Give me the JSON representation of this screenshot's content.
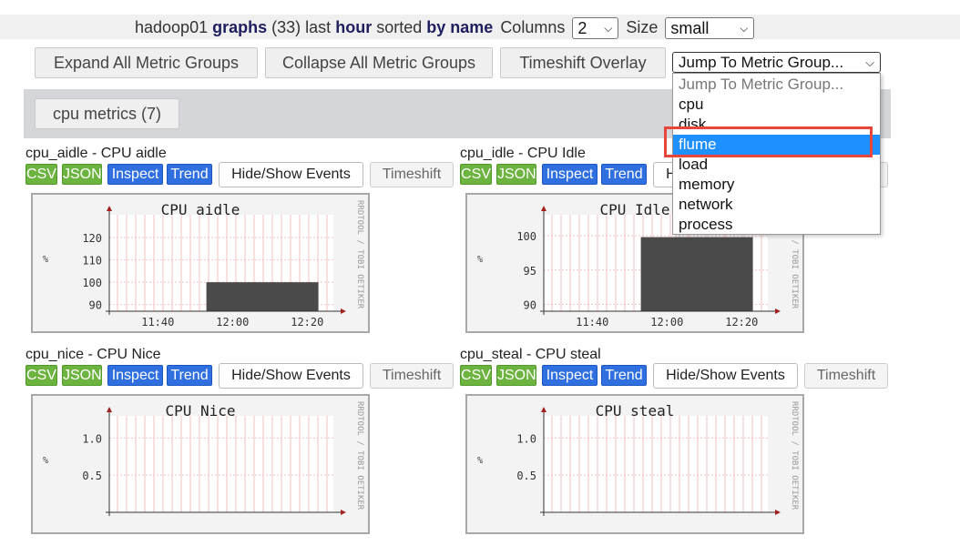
{
  "header": {
    "host": "hadoop01",
    "graphs_word": "graphs",
    "count": "(33)",
    "last_word": "last",
    "range": "hour",
    "sorted_word": "sorted",
    "sort": "by name",
    "columns_label": "Columns",
    "columns_value": "2",
    "size_label": "Size",
    "size_value": "small"
  },
  "toolbar": {
    "expand": "Expand All Metric Groups",
    "collapse": "Collapse All Metric Groups",
    "timeshift_overlay": "Timeshift Overlay",
    "jump_placeholder": "Jump To Metric Group..."
  },
  "dropdown": {
    "options": [
      "Jump To Metric Group...",
      "cpu",
      "disk",
      "flume",
      "load",
      "memory",
      "network",
      "process"
    ],
    "selected": "flume"
  },
  "group": {
    "label": "cpu metrics (7)"
  },
  "graph_buttons": [
    "CSV",
    "JSON",
    "Inspect",
    "Trend",
    "Hide/Show Events",
    "Timeshift"
  ],
  "side_text": "RRDTOOL / TOBI OETIKER",
  "ylabel": "%",
  "graphs": [
    {
      "title": "cpu_aidle - CPU aidle",
      "chart_data": {
        "type": "area",
        "title": "CPU aidle",
        "x_ticks": [
          "11:40",
          "12:00",
          "12:20"
        ],
        "y_ticks": [
          "120",
          "110",
          "100",
          "90"
        ],
        "ylim": [
          87,
          127
        ],
        "series": [
          {
            "x_start": "11:53",
            "x_end": "12:23",
            "value": 100
          }
        ]
      }
    },
    {
      "title": "cpu_idle - CPU Idle",
      "chart_data": {
        "type": "area",
        "title": "CPU Idle",
        "x_ticks": [
          "11:40",
          "12:00",
          "12:20"
        ],
        "y_ticks": [
          "100",
          "95",
          "90"
        ],
        "ylim": [
          89,
          102
        ],
        "series": [
          {
            "x_start": "11:53",
            "x_end": "12:23",
            "value": 99.8
          }
        ]
      }
    },
    {
      "title": "cpu_nice - CPU Nice",
      "chart_data": {
        "type": "area",
        "title": "CPU Nice",
        "x_ticks": [],
        "y_ticks": [
          "1.0",
          "0.5"
        ],
        "ylim": [
          0,
          1.2
        ],
        "series": []
      }
    },
    {
      "title": "cpu_steal - CPU steal",
      "chart_data": {
        "type": "area",
        "title": "CPU steal",
        "x_ticks": [],
        "y_ticks": [
          "1.0",
          "0.5"
        ],
        "ylim": [
          0,
          1.2
        ],
        "series": []
      }
    }
  ]
}
